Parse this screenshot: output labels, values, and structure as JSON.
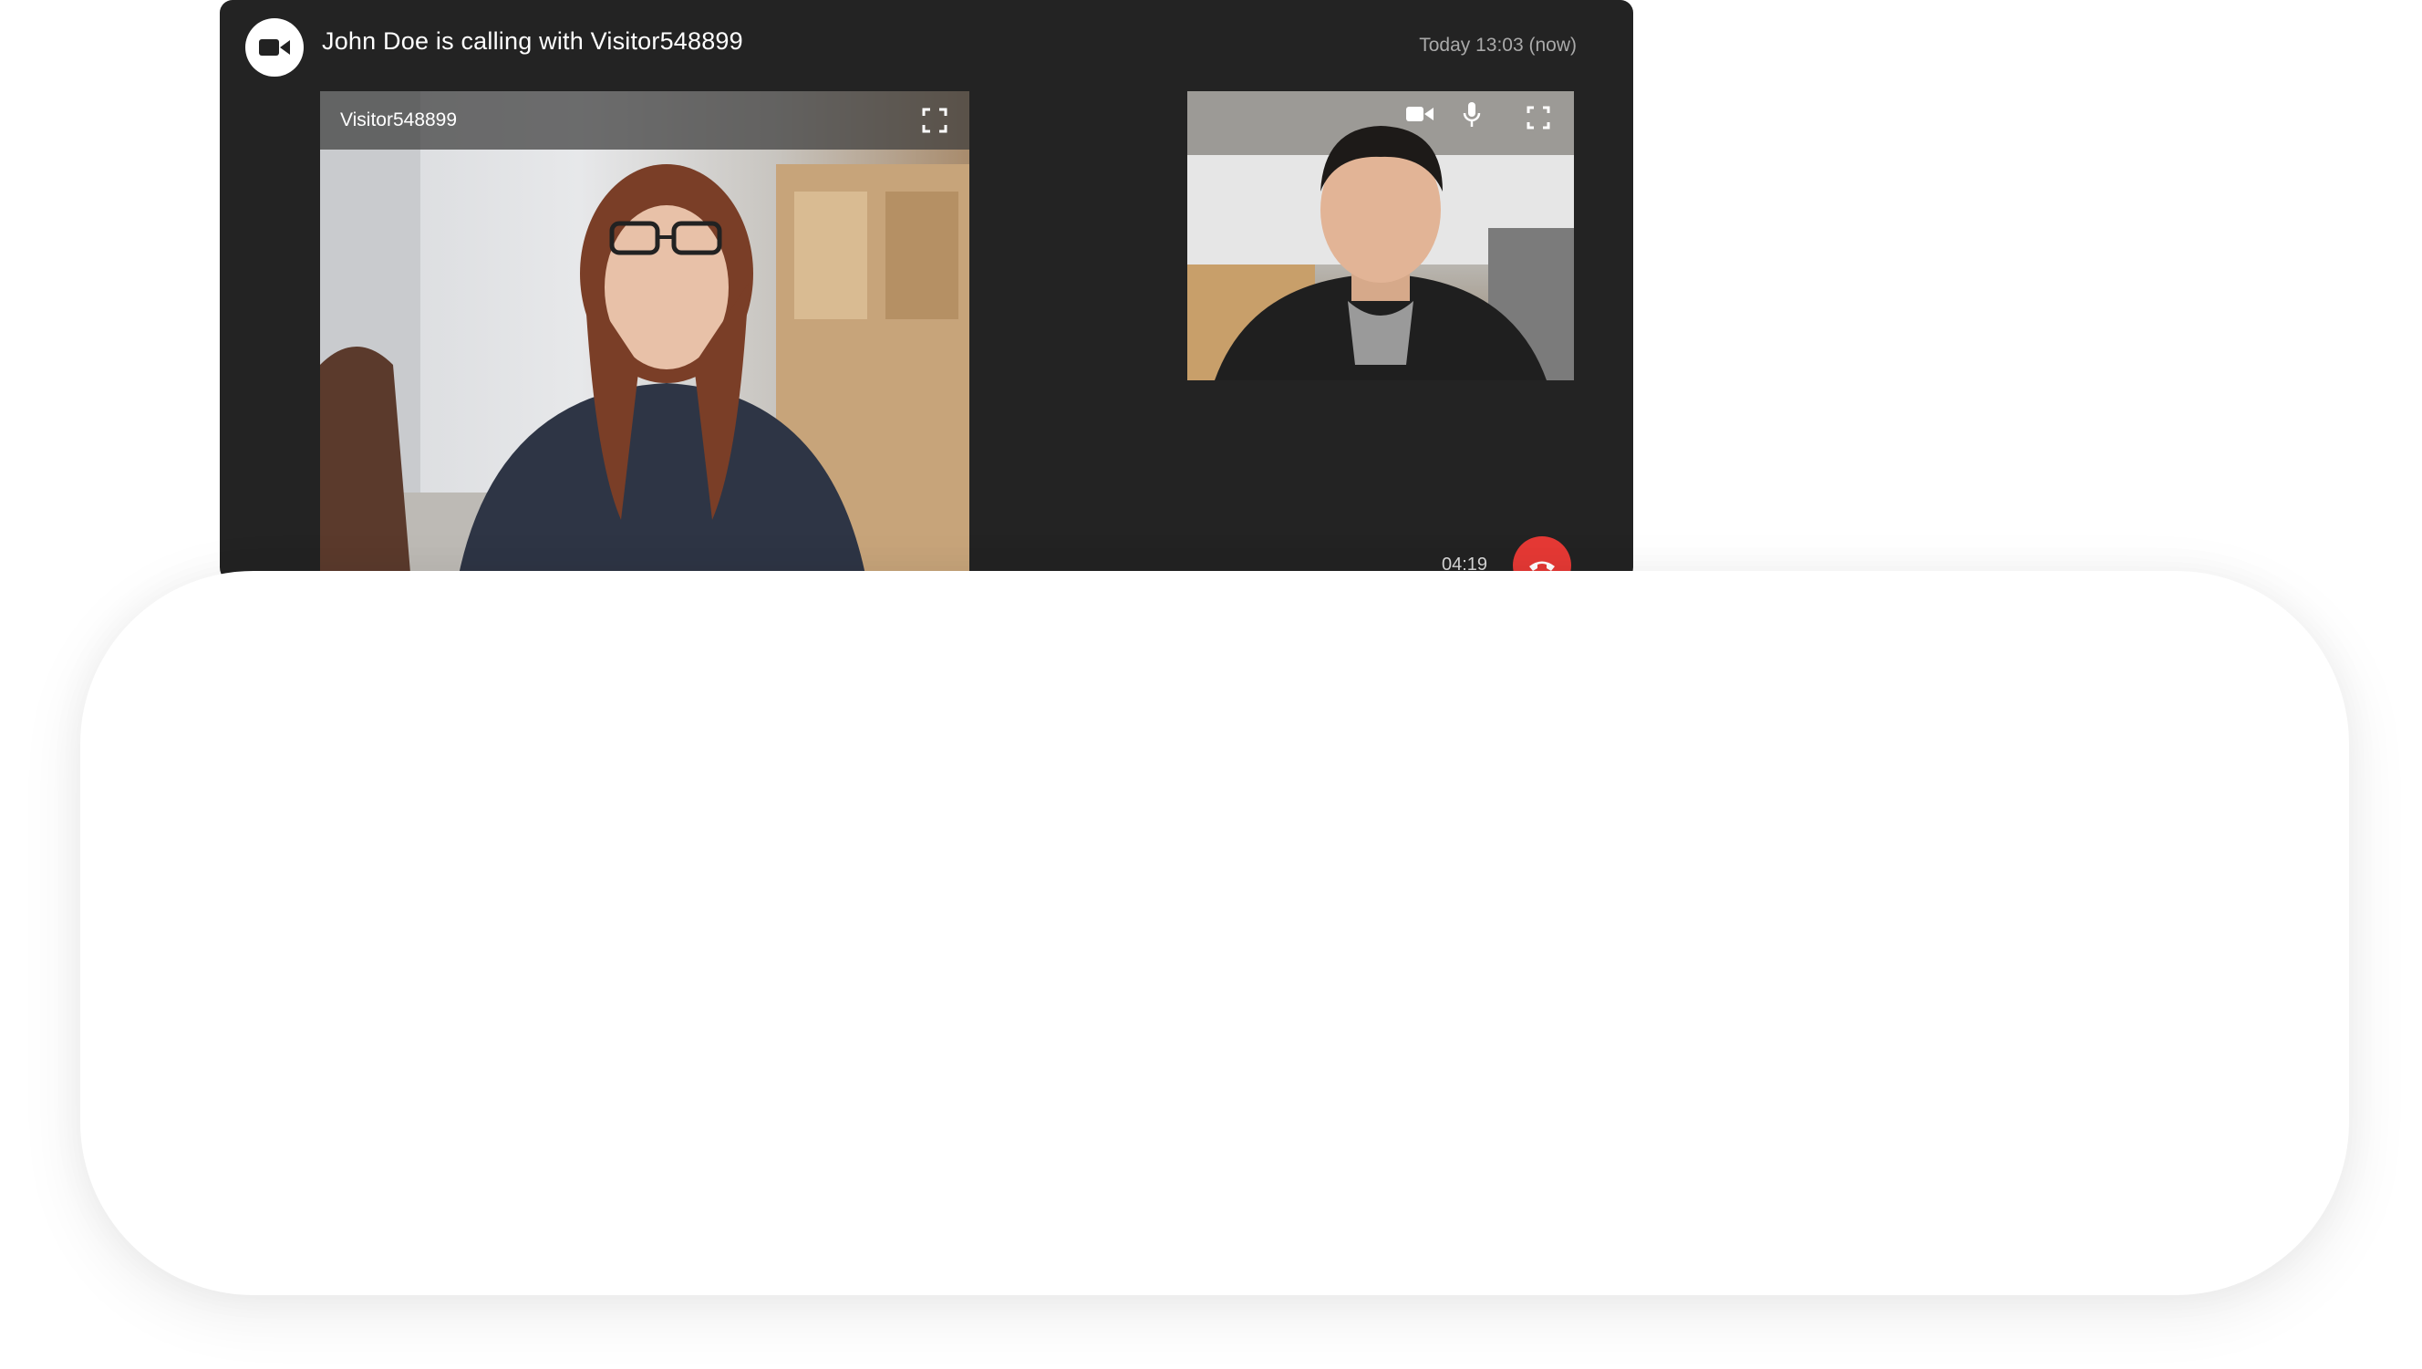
{
  "call": {
    "title": "John Doe is calling with Visitor548899",
    "time": "Today 13:03 (now)",
    "duration": "04:19"
  },
  "remote": {
    "name": "Visitor548899"
  },
  "icons": {
    "header": "video-camera-icon",
    "fullscreen": "fullscreen-icon",
    "camera": "camera-toggle-icon",
    "mic": "microphone-icon",
    "hangup": "phone-hangup-icon"
  },
  "colors": {
    "panel": "#232323",
    "hangup": "#e53935"
  }
}
